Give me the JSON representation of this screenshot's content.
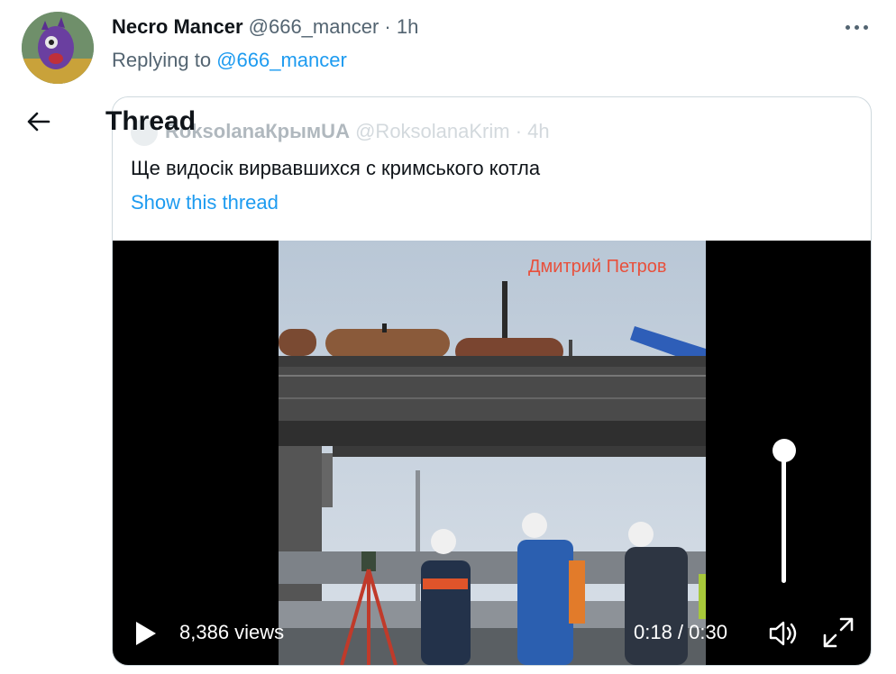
{
  "tweet": {
    "author_name": "Necro Mancer",
    "author_handle": "@666_mancer",
    "separator": "·",
    "time_ago": "1h",
    "replying_to_prefix": "Replying to",
    "replying_to_handle": "@666_mancer"
  },
  "thread_header": {
    "title": "Thread"
  },
  "quoted": {
    "author_name": "RoksolanaКрымUA",
    "author_handle": "@RoksolanaKrim",
    "separator": "·",
    "time_ago": "4h",
    "text": "Ще видосік вирвавшихся с кримського котла",
    "show_thread": "Show this thread"
  },
  "video": {
    "watermark": "Дмитрий Петров",
    "views": "8,386 views",
    "time": "0:18 / 0:30",
    "volume_level": 0.97
  },
  "colors": {
    "link": "#1d9bf0",
    "secondary_text": "#536471",
    "watermark": "#e8503c"
  },
  "icons": [
    "avatar",
    "more-icon",
    "back-arrow-icon",
    "play-icon",
    "volume-icon",
    "fullscreen-icon"
  ]
}
